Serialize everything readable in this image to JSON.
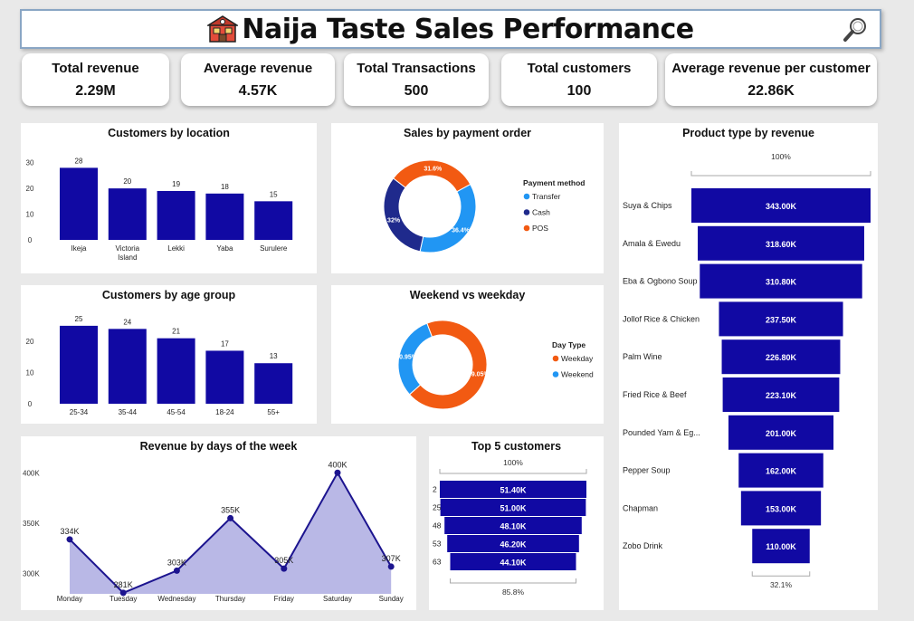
{
  "header": {
    "title": "Naija Taste Sales Performance"
  },
  "kpis": [
    {
      "label": "Total revenue",
      "value": "2.29M"
    },
    {
      "label": "Average revenue",
      "value": "4.57K"
    },
    {
      "label": "Total Transactions",
      "value": "500"
    },
    {
      "label": "Total customers",
      "value": "100"
    },
    {
      "label": "Average revenue per customer",
      "value": "22.86K"
    }
  ],
  "colors": {
    "bar": "#1109a3",
    "blue": "#2196f3",
    "navy": "#1f2a8c",
    "orange": "#f25a12",
    "area": "#b9b8e6",
    "line": "#1c148f"
  },
  "cards": {
    "location": "Customers by location",
    "payment": "Sales by payment order",
    "product": "Product type by revenue",
    "age": "Customers by age group",
    "weekend": "Weekend vs weekday",
    "days": "Revenue by days of the week",
    "top5": "Top 5 customers"
  },
  "chart_data": [
    {
      "type": "bar",
      "title": "Customers by location",
      "categories": [
        "Ikeja",
        "Victoria Island",
        "Lekki",
        "Yaba",
        "Surulere"
      ],
      "values": [
        28,
        20,
        19,
        18,
        15
      ],
      "yticks": [
        0,
        10,
        20,
        30
      ],
      "ylim": [
        0,
        32
      ]
    },
    {
      "type": "pie",
      "title": "Sales by payment order",
      "legend_title": "Payment method",
      "labels": [
        "Transfer",
        "Cash",
        "POS"
      ],
      "values": [
        36.4,
        32,
        31.6
      ],
      "display_labels": [
        "36.4%",
        "32%",
        "31.6%"
      ],
      "colors": [
        "#2196f3",
        "#1f2a8c",
        "#f25a12"
      ]
    },
    {
      "type": "bar",
      "title": "Product type by revenue",
      "categories": [
        "Suya & Chips",
        "Amala & Ewedu",
        "Eba & Ogbono Soup",
        "Jollof Rice & Chicken",
        "Palm Wine",
        "Fried Rice & Beef",
        "Pounded Yam & Eg...",
        "Pepper Soup",
        "Chapman",
        "Zobo Drink"
      ],
      "values": [
        343.0,
        318.6,
        310.8,
        237.5,
        226.8,
        223.1,
        201.0,
        162.0,
        153.0,
        110.0
      ],
      "display_labels": [
        "343.00K",
        "318.60K",
        "310.80K",
        "237.50K",
        "226.80K",
        "223.10K",
        "201.00K",
        "162.00K",
        "153.00K",
        "110.00K"
      ],
      "top_label": "100%",
      "bottom_label": "32.1%"
    },
    {
      "type": "bar",
      "title": "Customers by age group",
      "categories": [
        "25-34",
        "35-44",
        "45-54",
        "18-24",
        "55+"
      ],
      "values": [
        25,
        24,
        21,
        17,
        13
      ],
      "yticks": [
        0,
        10,
        20
      ],
      "ylim": [
        0,
        27
      ]
    },
    {
      "type": "pie",
      "title": "Weekend vs weekday",
      "legend_title": "Day Type",
      "labels": [
        "Weekday",
        "Weekend"
      ],
      "values": [
        69.05,
        30.95
      ],
      "display_labels": [
        "69.05%",
        "30.95%"
      ],
      "colors": [
        "#f25a12",
        "#2196f3"
      ]
    },
    {
      "type": "area",
      "title": "Revenue by days of the week",
      "categories": [
        "Monday",
        "Tuesday",
        "Wednesday",
        "Thursday",
        "Friday",
        "Saturday",
        "Sunday"
      ],
      "values": [
        334,
        281,
        303,
        355,
        305,
        400,
        307
      ],
      "display_labels": [
        "334K",
        "281K",
        "303K",
        "355K",
        "305K",
        "400K",
        "307K"
      ],
      "yticks": [
        300,
        350,
        400
      ],
      "ytick_labels": [
        "300K",
        "350K",
        "400K"
      ],
      "ylim": [
        280,
        420
      ]
    },
    {
      "type": "bar",
      "title": "Top 5 customers",
      "categories": [
        "2",
        "25",
        "48",
        "53",
        "63"
      ],
      "values": [
        51.4,
        51.0,
        48.1,
        46.2,
        44.1
      ],
      "display_labels": [
        "51.40K",
        "51.00K",
        "48.10K",
        "46.20K",
        "44.10K"
      ],
      "top_label": "100%",
      "bottom_label": "85.8%"
    }
  ]
}
